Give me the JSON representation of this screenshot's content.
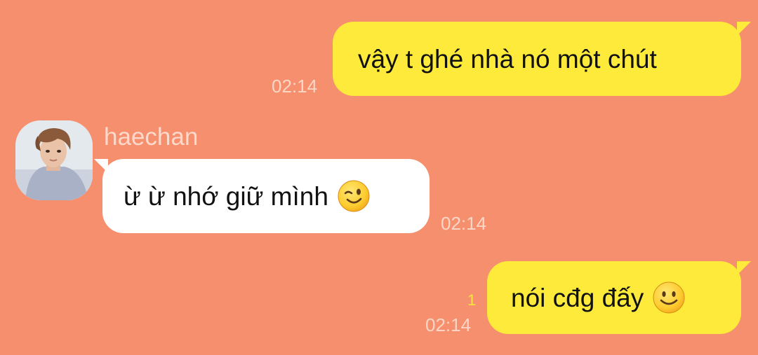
{
  "colors": {
    "background": "#F68F6E",
    "outgoing_bubble": "#FDEA3B",
    "incoming_bubble": "#FFFFFF",
    "timestamp": "#F9D6C6",
    "read_count": "#FBE43F"
  },
  "messages": [
    {
      "direction": "outgoing",
      "text": "vậy t ghé nhà nó một chút",
      "time": "02:14"
    },
    {
      "direction": "incoming",
      "sender": "haechan",
      "text": "ừ ừ nhớ giữ mình",
      "emoji": "winking-face-emoji",
      "time": "02:14"
    },
    {
      "direction": "outgoing",
      "text": "nói cđg đấy",
      "emoji": "smiling-face-emoji",
      "time": "02:14",
      "unread_count": "1"
    }
  ]
}
